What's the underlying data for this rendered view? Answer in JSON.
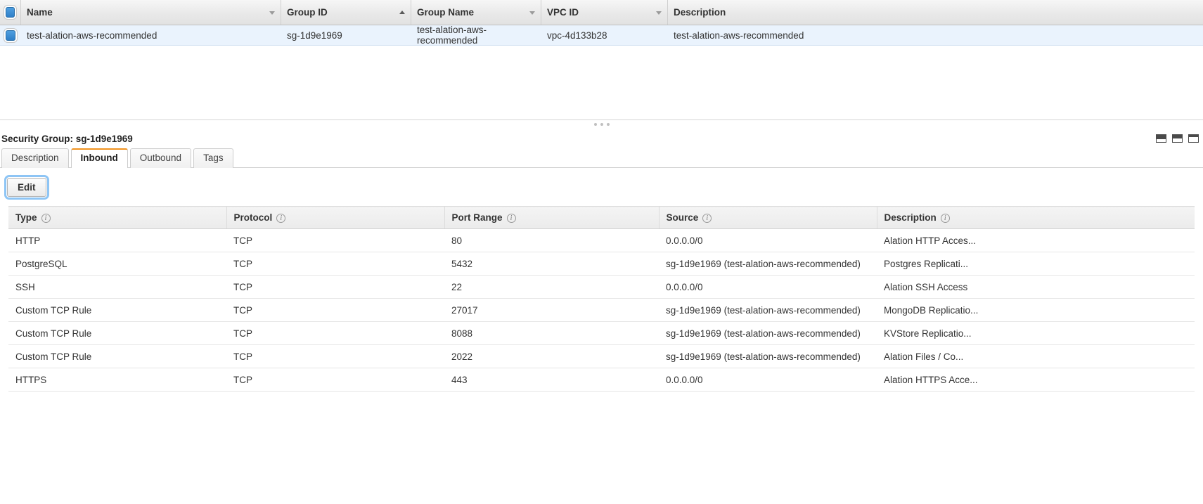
{
  "security_group_list": {
    "columns": [
      {
        "label": "Name",
        "sort": "down"
      },
      {
        "label": "Group ID",
        "sort": "up"
      },
      {
        "label": "Group Name",
        "sort": "down"
      },
      {
        "label": "VPC ID",
        "sort": "down"
      },
      {
        "label": "Description",
        "sort": "none"
      }
    ],
    "header_checkbox": "checkbox-checked-icon",
    "rows": [
      {
        "selected": true,
        "name": "test-alation-aws-recommended",
        "group_id": "sg-1d9e1969",
        "group_name": "test-alation-aws-recommended",
        "vpc_id": "vpc-4d133b28",
        "description": "test-alation-aws-recommended"
      }
    ]
  },
  "detail_panel": {
    "title": "Security Group: sg-1d9e1969",
    "layout_buttons": [
      "panel-layout-bottom-icon",
      "panel-layout-split-icon",
      "panel-layout-side-icon"
    ],
    "tabs": [
      {
        "label": "Description",
        "active": false
      },
      {
        "label": "Inbound",
        "active": true
      },
      {
        "label": "Outbound",
        "active": false
      },
      {
        "label": "Tags",
        "active": false
      }
    ],
    "edit_label": "Edit",
    "active_tab_accent": "#f0921e",
    "rules_table": {
      "columns": [
        {
          "label": "Type",
          "info": "info-icon"
        },
        {
          "label": "Protocol",
          "info": "info-icon"
        },
        {
          "label": "Port Range",
          "info": "info-icon"
        },
        {
          "label": "Source",
          "info": "info-icon"
        },
        {
          "label": "Description",
          "info": "info-icon"
        }
      ],
      "rows": [
        {
          "type": "HTTP",
          "protocol": "TCP",
          "port_range": "80",
          "source": "0.0.0.0/0",
          "description": "Alation HTTP Acces..."
        },
        {
          "type": "PostgreSQL",
          "protocol": "TCP",
          "port_range": "5432",
          "source": "sg-1d9e1969 (test-alation-aws-recommended)",
          "description": "Postgres Replicati..."
        },
        {
          "type": "SSH",
          "protocol": "TCP",
          "port_range": "22",
          "source": "0.0.0.0/0",
          "description": "Alation SSH Access"
        },
        {
          "type": "Custom TCP Rule",
          "protocol": "TCP",
          "port_range": "27017",
          "source": "sg-1d9e1969 (test-alation-aws-recommended)",
          "description": "MongoDB Replicatio..."
        },
        {
          "type": "Custom TCP Rule",
          "protocol": "TCP",
          "port_range": "8088",
          "source": "sg-1d9e1969 (test-alation-aws-recommended)",
          "description": "KVStore Replicatio..."
        },
        {
          "type": "Custom TCP Rule",
          "protocol": "TCP",
          "port_range": "2022",
          "source": "sg-1d9e1969 (test-alation-aws-recommended)",
          "description": "Alation Files / Co..."
        },
        {
          "type": "HTTPS",
          "protocol": "TCP",
          "port_range": "443",
          "source": "0.0.0.0/0",
          "description": "Alation HTTPS Acce..."
        }
      ]
    }
  }
}
